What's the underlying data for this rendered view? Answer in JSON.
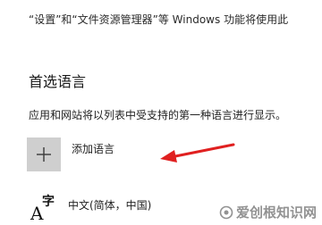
{
  "header": {
    "description": "“设置”和“文件资源管理器”等 Windows 功能将使用此"
  },
  "preferred_languages": {
    "title": "首选语言",
    "description": "应用和网站将以列表中受支持的第一种语言进行显示。",
    "add_button": {
      "icon": "plus-icon",
      "label": "添加语言"
    },
    "languages": [
      {
        "icon": "language-glyph-icon",
        "glyph_a": "A",
        "glyph_zi": "字",
        "name": "中文(简体，中国)"
      }
    ]
  },
  "annotation": {
    "arrow_color": "#e02020"
  },
  "watermark": {
    "text": "爱创根知识网"
  },
  "colors": {
    "add_tile_bg": "#cfcfcf",
    "page_bg": "#ffffff"
  }
}
